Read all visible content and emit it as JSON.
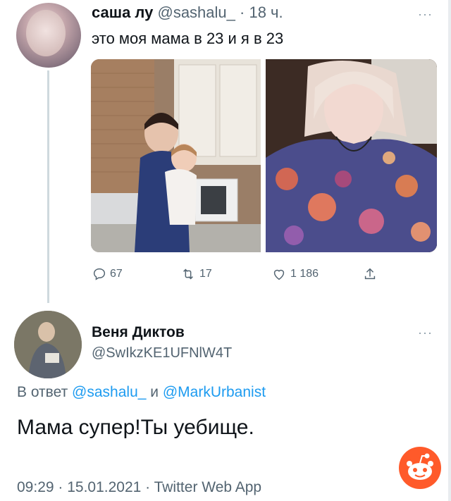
{
  "tweet": {
    "name": "саша лу",
    "handle": "@sashalu_",
    "separator": " · ",
    "time": "18 ч.",
    "text": "это моя мама в 23 и я в 23",
    "more": "···",
    "stats": {
      "replies": "67",
      "retweets": "17",
      "likes": "1 186"
    }
  },
  "reply": {
    "name": "Веня Диктов",
    "handle": "@SwIkzKE1UFNlW4T",
    "more": "···",
    "reply_prefix": "В ответ ",
    "mention1": "@sashalu_",
    "conjunction": " и ",
    "mention2": "@MarkUrbanist",
    "text": "Мама супер!Ты уебище.",
    "meta": "09:29 · 15.01.2021 · Twitter Web App"
  },
  "colors": {
    "link": "#1d9bf0",
    "secondary_text": "#536471",
    "reddit_orange": "#ff5a2a"
  }
}
